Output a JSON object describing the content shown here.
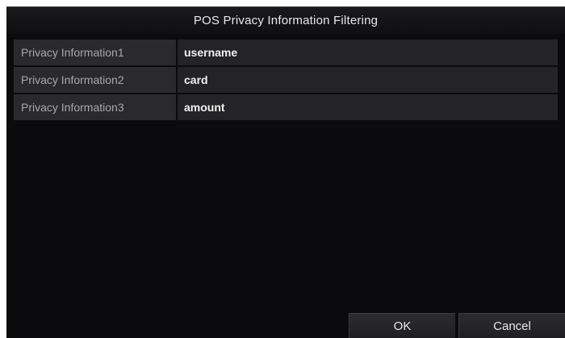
{
  "dialog": {
    "title": "POS Privacy Information Filtering"
  },
  "privacy_rows": [
    {
      "label": "Privacy Information1",
      "value": "username"
    },
    {
      "label": "Privacy Information2",
      "value": "card"
    },
    {
      "label": "Privacy Information3",
      "value": "amount"
    }
  ],
  "buttons": {
    "ok_label": "OK",
    "cancel_label": "Cancel"
  },
  "colors": {
    "dialog_background": "#0b0b0d",
    "label_cell": "#2a2a2c",
    "value_cell": "#242426",
    "text_primary": "#f2f2f2",
    "text_secondary": "#a8a8aa"
  }
}
